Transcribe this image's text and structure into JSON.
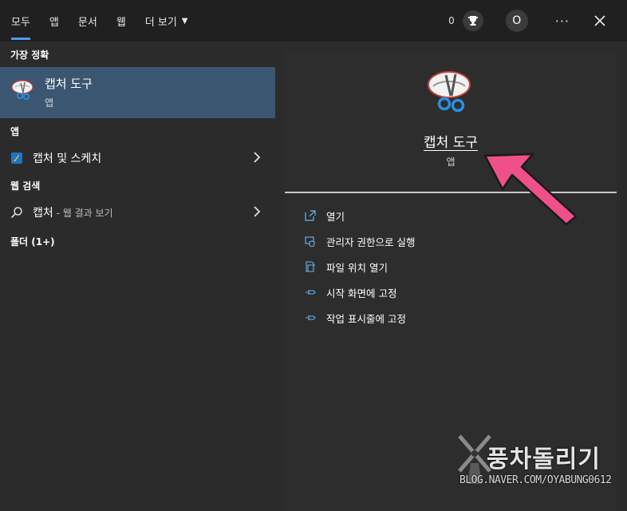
{
  "tabs": [
    {
      "label": "모두",
      "active": true
    },
    {
      "label": "앱"
    },
    {
      "label": "문서"
    },
    {
      "label": "웹"
    },
    {
      "label": "더 보기"
    }
  ],
  "top_right": {
    "points": "0",
    "avatar_letter": "O",
    "more_icon": "ellipsis-icon",
    "close_icon": "close-icon"
  },
  "left_panel": {
    "best_match_title": "가장 정확",
    "best_match": {
      "name": "캡처 도구",
      "type": "앱",
      "icon": "snipping-tool-icon"
    },
    "apps_title": "앱",
    "apps": [
      {
        "name": "캡처 및 스케치",
        "icon": "snip-sketch-icon"
      }
    ],
    "web_title": "웹 검색",
    "web": {
      "query": "캡처",
      "suffix": " - 웹 결과 보기"
    },
    "folders_title": "폴더 (1+)"
  },
  "right_panel": {
    "app_name": "캡처 도구",
    "app_type": "앱",
    "actions": [
      {
        "label": "열기",
        "icon": "open-icon"
      },
      {
        "label": "관리자 권한으로 실행",
        "icon": "shield-icon"
      },
      {
        "label": "파일 위치 열기",
        "icon": "folder-icon"
      },
      {
        "label": "시작 화면에 고정",
        "icon": "pin-icon"
      },
      {
        "label": "작업 표시줄에 고정",
        "icon": "pin-icon"
      }
    ]
  },
  "watermark": {
    "title": "풍차돌리기",
    "url": "BLOG.NAVER.COM/OYABUNG0612"
  },
  "colors": {
    "accent": "#4a9ee8",
    "selection": "#3b5670",
    "arrow": "#f0508a"
  }
}
